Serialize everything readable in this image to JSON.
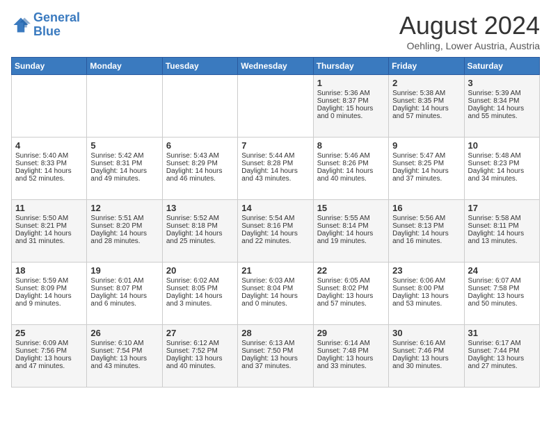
{
  "logo": {
    "line1": "General",
    "line2": "Blue"
  },
  "title": "August 2024",
  "location": "Oehling, Lower Austria, Austria",
  "days_of_week": [
    "Sunday",
    "Monday",
    "Tuesday",
    "Wednesday",
    "Thursday",
    "Friday",
    "Saturday"
  ],
  "weeks": [
    [
      {
        "day": "",
        "info": ""
      },
      {
        "day": "",
        "info": ""
      },
      {
        "day": "",
        "info": ""
      },
      {
        "day": "",
        "info": ""
      },
      {
        "day": "1",
        "sunrise": "Sunrise: 5:36 AM",
        "sunset": "Sunset: 8:37 PM",
        "daylight": "Daylight: 15 hours and 0 minutes."
      },
      {
        "day": "2",
        "sunrise": "Sunrise: 5:38 AM",
        "sunset": "Sunset: 8:35 PM",
        "daylight": "Daylight: 14 hours and 57 minutes."
      },
      {
        "day": "3",
        "sunrise": "Sunrise: 5:39 AM",
        "sunset": "Sunset: 8:34 PM",
        "daylight": "Daylight: 14 hours and 55 minutes."
      }
    ],
    [
      {
        "day": "4",
        "sunrise": "Sunrise: 5:40 AM",
        "sunset": "Sunset: 8:33 PM",
        "daylight": "Daylight: 14 hours and 52 minutes."
      },
      {
        "day": "5",
        "sunrise": "Sunrise: 5:42 AM",
        "sunset": "Sunset: 8:31 PM",
        "daylight": "Daylight: 14 hours and 49 minutes."
      },
      {
        "day": "6",
        "sunrise": "Sunrise: 5:43 AM",
        "sunset": "Sunset: 8:29 PM",
        "daylight": "Daylight: 14 hours and 46 minutes."
      },
      {
        "day": "7",
        "sunrise": "Sunrise: 5:44 AM",
        "sunset": "Sunset: 8:28 PM",
        "daylight": "Daylight: 14 hours and 43 minutes."
      },
      {
        "day": "8",
        "sunrise": "Sunrise: 5:46 AM",
        "sunset": "Sunset: 8:26 PM",
        "daylight": "Daylight: 14 hours and 40 minutes."
      },
      {
        "day": "9",
        "sunrise": "Sunrise: 5:47 AM",
        "sunset": "Sunset: 8:25 PM",
        "daylight": "Daylight: 14 hours and 37 minutes."
      },
      {
        "day": "10",
        "sunrise": "Sunrise: 5:48 AM",
        "sunset": "Sunset: 8:23 PM",
        "daylight": "Daylight: 14 hours and 34 minutes."
      }
    ],
    [
      {
        "day": "11",
        "sunrise": "Sunrise: 5:50 AM",
        "sunset": "Sunset: 8:21 PM",
        "daylight": "Daylight: 14 hours and 31 minutes."
      },
      {
        "day": "12",
        "sunrise": "Sunrise: 5:51 AM",
        "sunset": "Sunset: 8:20 PM",
        "daylight": "Daylight: 14 hours and 28 minutes."
      },
      {
        "day": "13",
        "sunrise": "Sunrise: 5:52 AM",
        "sunset": "Sunset: 8:18 PM",
        "daylight": "Daylight: 14 hours and 25 minutes."
      },
      {
        "day": "14",
        "sunrise": "Sunrise: 5:54 AM",
        "sunset": "Sunset: 8:16 PM",
        "daylight": "Daylight: 14 hours and 22 minutes."
      },
      {
        "day": "15",
        "sunrise": "Sunrise: 5:55 AM",
        "sunset": "Sunset: 8:14 PM",
        "daylight": "Daylight: 14 hours and 19 minutes."
      },
      {
        "day": "16",
        "sunrise": "Sunrise: 5:56 AM",
        "sunset": "Sunset: 8:13 PM",
        "daylight": "Daylight: 14 hours and 16 minutes."
      },
      {
        "day": "17",
        "sunrise": "Sunrise: 5:58 AM",
        "sunset": "Sunset: 8:11 PM",
        "daylight": "Daylight: 14 hours and 13 minutes."
      }
    ],
    [
      {
        "day": "18",
        "sunrise": "Sunrise: 5:59 AM",
        "sunset": "Sunset: 8:09 PM",
        "daylight": "Daylight: 14 hours and 9 minutes."
      },
      {
        "day": "19",
        "sunrise": "Sunrise: 6:01 AM",
        "sunset": "Sunset: 8:07 PM",
        "daylight": "Daylight: 14 hours and 6 minutes."
      },
      {
        "day": "20",
        "sunrise": "Sunrise: 6:02 AM",
        "sunset": "Sunset: 8:05 PM",
        "daylight": "Daylight: 14 hours and 3 minutes."
      },
      {
        "day": "21",
        "sunrise": "Sunrise: 6:03 AM",
        "sunset": "Sunset: 8:04 PM",
        "daylight": "Daylight: 14 hours and 0 minutes."
      },
      {
        "day": "22",
        "sunrise": "Sunrise: 6:05 AM",
        "sunset": "Sunset: 8:02 PM",
        "daylight": "Daylight: 13 hours and 57 minutes."
      },
      {
        "day": "23",
        "sunrise": "Sunrise: 6:06 AM",
        "sunset": "Sunset: 8:00 PM",
        "daylight": "Daylight: 13 hours and 53 minutes."
      },
      {
        "day": "24",
        "sunrise": "Sunrise: 6:07 AM",
        "sunset": "Sunset: 7:58 PM",
        "daylight": "Daylight: 13 hours and 50 minutes."
      }
    ],
    [
      {
        "day": "25",
        "sunrise": "Sunrise: 6:09 AM",
        "sunset": "Sunset: 7:56 PM",
        "daylight": "Daylight: 13 hours and 47 minutes."
      },
      {
        "day": "26",
        "sunrise": "Sunrise: 6:10 AM",
        "sunset": "Sunset: 7:54 PM",
        "daylight": "Daylight: 13 hours and 43 minutes."
      },
      {
        "day": "27",
        "sunrise": "Sunrise: 6:12 AM",
        "sunset": "Sunset: 7:52 PM",
        "daylight": "Daylight: 13 hours and 40 minutes."
      },
      {
        "day": "28",
        "sunrise": "Sunrise: 6:13 AM",
        "sunset": "Sunset: 7:50 PM",
        "daylight": "Daylight: 13 hours and 37 minutes."
      },
      {
        "day": "29",
        "sunrise": "Sunrise: 6:14 AM",
        "sunset": "Sunset: 7:48 PM",
        "daylight": "Daylight: 13 hours and 33 minutes."
      },
      {
        "day": "30",
        "sunrise": "Sunrise: 6:16 AM",
        "sunset": "Sunset: 7:46 PM",
        "daylight": "Daylight: 13 hours and 30 minutes."
      },
      {
        "day": "31",
        "sunrise": "Sunrise: 6:17 AM",
        "sunset": "Sunset: 7:44 PM",
        "daylight": "Daylight: 13 hours and 27 minutes."
      }
    ]
  ]
}
